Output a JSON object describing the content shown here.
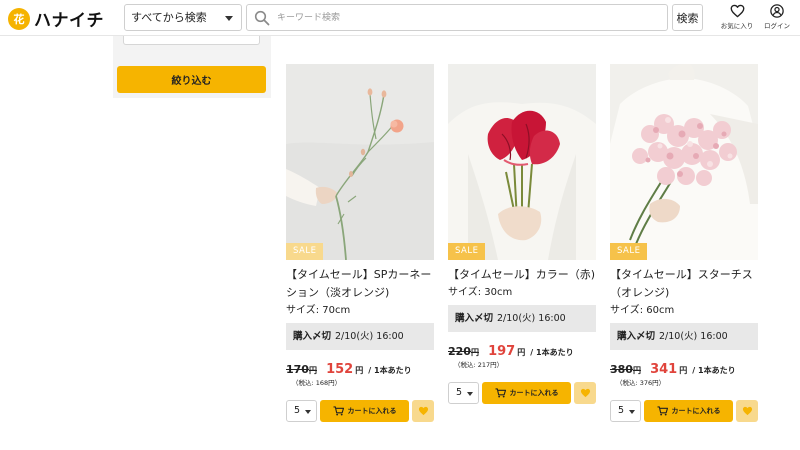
{
  "header": {
    "logo_mark": "花",
    "logo_text": "ハナイチ",
    "category_select": "すべてから検索",
    "search_placeholder": "キーワード検索",
    "search_button": "検索",
    "favorites_label": "お気に入り",
    "login_label": "ログイン"
  },
  "sidebar": {
    "filter_button": "絞り込む"
  },
  "colors": {
    "accent": "#f6b400",
    "sale_price": "#e0443c",
    "sale_badge": "#f6c24a",
    "deadline_bg": "#e8e8e8"
  },
  "products": [
    {
      "badge": "SALE",
      "title": "【タイムセール】SPカーネーション（淡オレンジ)",
      "size": "サイズ: 70cm",
      "deadline_label": "購入〆切",
      "deadline_value": "2/10(火) 16:00",
      "old_price": "170",
      "new_price": "152",
      "yen": "円",
      "per_unit": "/ 1本あたり",
      "tax_note": "（税込: 168円）",
      "qty": "5",
      "cart_label": "カートに入れる",
      "image": "orange-carnation-stem"
    },
    {
      "badge": "SALE",
      "title": "【タイムセール】カラー（赤)",
      "size": "サイズ: 30cm",
      "deadline_label": "購入〆切",
      "deadline_value": "2/10(火) 16:00",
      "old_price": "220",
      "new_price": "197",
      "yen": "円",
      "per_unit": "/ 1本あたり",
      "tax_note": "（税込: 217円）",
      "qty": "5",
      "cart_label": "カートに入れる",
      "image": "red-calla-bouquet"
    },
    {
      "badge": "SALE",
      "title": "【タイムセール】スターチス（オレンジ)",
      "size": "サイズ: 60cm",
      "deadline_label": "購入〆切",
      "deadline_value": "2/10(火) 16:00",
      "old_price": "380",
      "new_price": "341",
      "yen": "円",
      "per_unit": "/ 1本あたり",
      "tax_note": "（税込: 376円）",
      "qty": "5",
      "cart_label": "カートに入れる",
      "image": "pink-statice-bouquet"
    }
  ]
}
